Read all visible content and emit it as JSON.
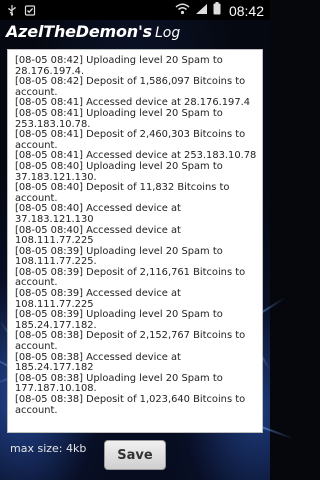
{
  "status_bar": {
    "time": "08:42",
    "left_icons": [
      "usb-icon",
      "tasks-check-icon"
    ],
    "right_icons": [
      "wifi-icon",
      "signal-icon",
      "battery-icon"
    ]
  },
  "title": {
    "main": "AzelTheDemon's",
    "sub": "Log"
  },
  "log": {
    "lines": [
      "[08-05 08:42] Uploading level 20 Spam to 28.176.197.4.",
      "[08-05 08:42] Deposit of 1,586,097 Bitcoins to account.",
      "[08-05 08:41] Accessed device at 28.176.197.4",
      "[08-05 08:41] Uploading level 20 Spam to 253.183.10.78.",
      "[08-05 08:41] Deposit of 2,460,303 Bitcoins to account.",
      "[08-05 08:41] Accessed device at 253.183.10.78",
      "[08-05 08:40] Uploading level 20 Spam to 37.183.121.130.",
      "[08-05 08:40] Deposit of 11,832 Bitcoins to account.",
      "[08-05 08:40] Accessed device at 37.183.121.130",
      "[08-05 08:40] Accessed device at 108.111.77.225",
      "[08-05 08:39] Uploading level 20 Spam to 108.111.77.225.",
      "[08-05 08:39] Deposit of 2,116,761 Bitcoins to account.",
      "[08-05 08:39] Accessed device at 108.111.77.225",
      "[08-05 08:39] Uploading level 20 Spam to 185.24.177.182.",
      "[08-05 08:38] Deposit of 2,152,767 Bitcoins to account.",
      "[08-05 08:38] Accessed device at 185.24.177.182",
      "[08-05 08:38] Uploading level 20 Spam to 177.187.10.108.",
      "[08-05 08:38] Deposit of 1,023,640 Bitcoins to account."
    ]
  },
  "footer": {
    "max_size": "max size: 4kb",
    "save_label": "Save"
  }
}
